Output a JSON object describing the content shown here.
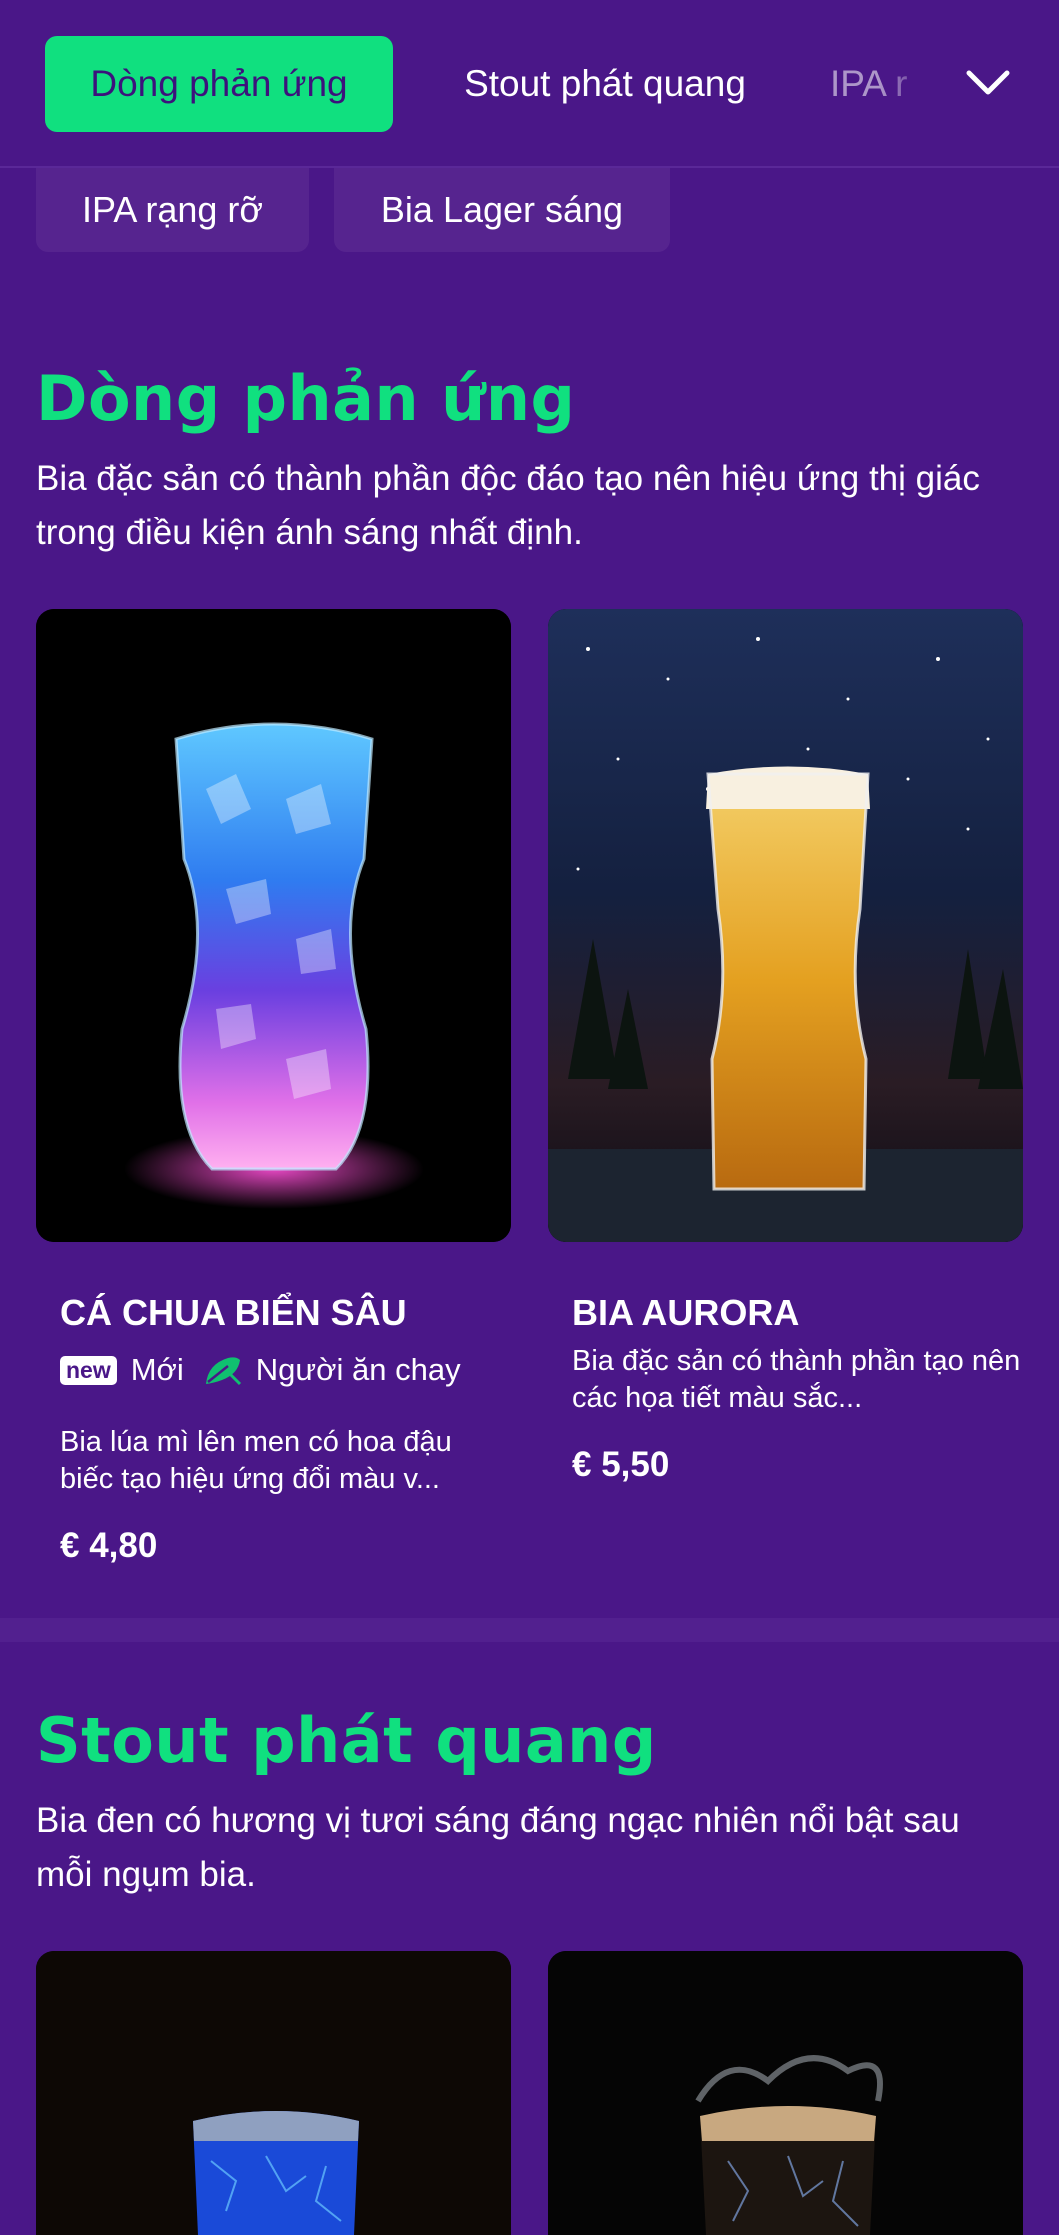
{
  "tabs": [
    {
      "label": "Dòng phản ứng"
    },
    {
      "label": "Stout phát quang"
    },
    {
      "label": "IPA r"
    }
  ],
  "chips": [
    {
      "label": "IPA rạng rỡ"
    },
    {
      "label": "Bia Lager sáng"
    }
  ],
  "sections": [
    {
      "title": "Dòng phản ứng",
      "description": "Bia đặc sản có thành phần độc đáo tạo nên hiệu ứng thị giác trong điều kiện ánh sáng nhất định.",
      "products": [
        {
          "name": "CÁ CHUA BIỂN SÂU",
          "badge_new": "new",
          "badge_new_label": "Mới",
          "badge_veg_label": "Người ăn chay",
          "description": "Bia lúa mì lên men có hoa đậu biếc tạo hiệu ứng đổi màu v...",
          "price": "€ 4,80"
        },
        {
          "name": "BIA AURORA",
          "description": "Bia đặc sản có thành phần tạo nên các họa tiết màu sắc...",
          "price": "€ 5,50"
        }
      ]
    },
    {
      "title": "Stout phát quang",
      "description": "Bia đen có hương vị tươi sáng đáng ngạc nhiên nổi bật sau mỗi ngụm bia."
    }
  ],
  "colors": {
    "background": "#4a1788",
    "accent": "#10e07f",
    "chip_bg": "#56248f"
  },
  "icons": {
    "dropdown": "chevron-down-icon",
    "vegetarian": "leaf-icon"
  }
}
